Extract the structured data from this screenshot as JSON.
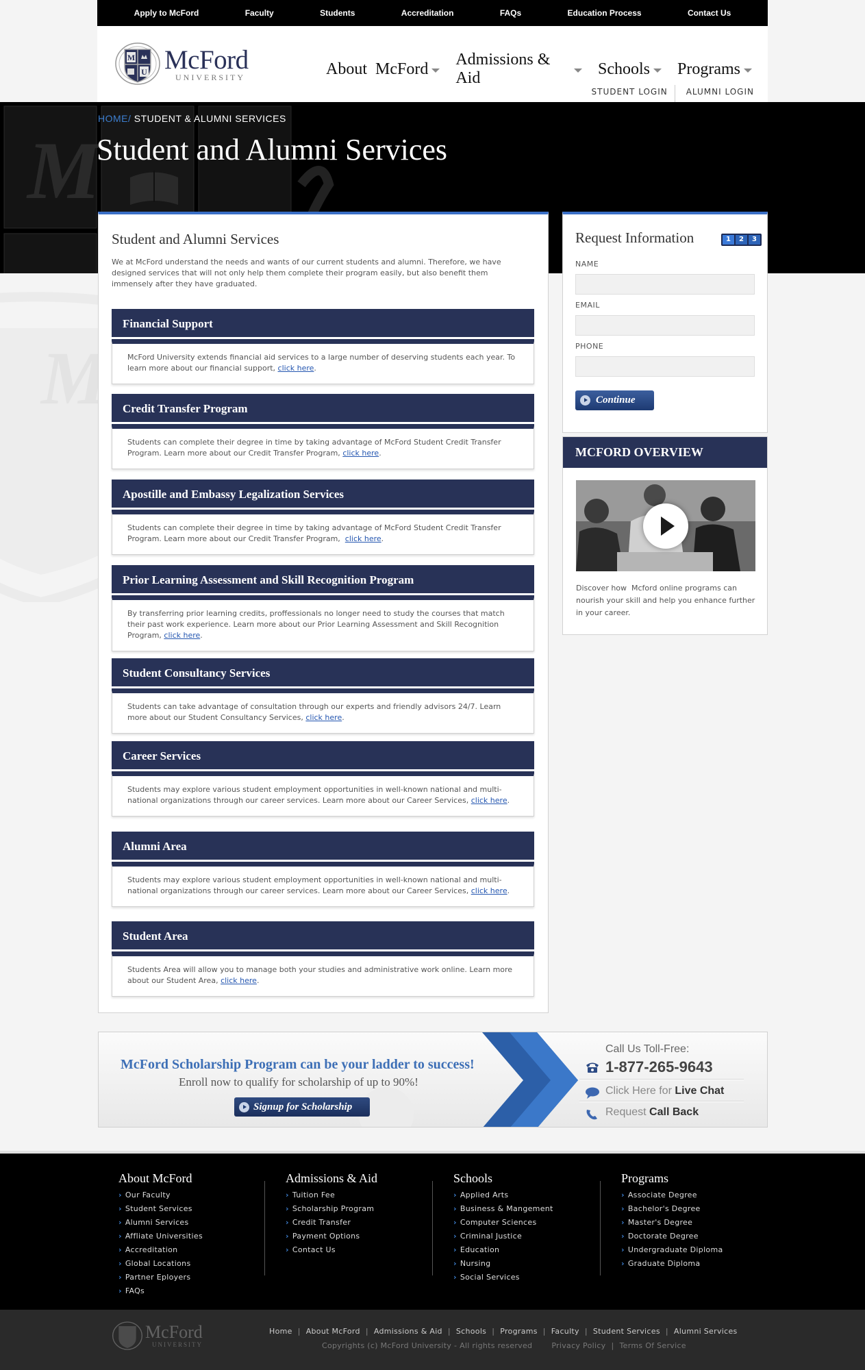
{
  "topbar": {
    "items": [
      "Apply to McFord",
      "Faculty",
      "Students",
      "Accreditation",
      "FAQs",
      "Education Process",
      "Contact Us"
    ]
  },
  "logo": {
    "name": "McFord",
    "sub": "UNIVERSITY",
    "crest_letters": [
      "M",
      "U"
    ]
  },
  "nav": {
    "items": [
      "About  McFord",
      "Admissions & Aid",
      "Schools",
      "Programs"
    ]
  },
  "logins": {
    "student": "STUDENT LOGIN",
    "alumni": "ALUMNI LOGIN"
  },
  "breadcrumb": {
    "home": "HOME",
    "sep": "/",
    "current": "STUDENT & ALUMNI SERVICES"
  },
  "page_title": "Student and Alumni Services",
  "main": {
    "heading": "Student and Alumni Services",
    "intro": "We at McFord understand the needs and wants of our current students and alumni. Therefore, we have designed services that will not only help them complete their program easily, but also benefit them immensely after they have graduated.",
    "sections": [
      {
        "title": "Financial Support",
        "text": "McFord University extends financial aid services to a large number of deserving students each year. To learn more about our financial support, ",
        "link": "click here",
        "end": "."
      },
      {
        "title": "Credit Transfer Program",
        "text": "Students can complete their degree in time by taking advantage of McFord Student Credit Transfer Program. Learn more about our Credit Transfer Program, ",
        "link": "click here",
        "end": "."
      },
      {
        "title": "Apostille and Embassy Legalization Services",
        "text": "Students can complete their degree in time by taking advantage of McFord Student Credit Transfer Program. Learn more about our Credit Transfer Program,  ",
        "link": "click here",
        "end": "."
      },
      {
        "title": "Prior Learning Assessment and Skill Recognition Program",
        "text": "By transferring prior learning credits, proffessionals no longer need to study the courses that match their past work experience.  Learn more about our Prior Learning Assessment and Skill Recognition Program, ",
        "link": "click here",
        "end": "."
      },
      {
        "title": "Student Consultancy Services",
        "text": "Students can take advantage of consultation through our experts and friendly advisors 24/7. Learn more about our Student Consultancy Services, ",
        "link": "click here",
        "end": "."
      },
      {
        "title": "Career Services",
        "text": "Students may explore various student employment opportunities in well-known national and multi-national organizations through our career services. Learn more about our Career Services, ",
        "link": "click here",
        "end": "."
      },
      {
        "title": "Alumni Area",
        "text": "Students may explore various student employment opportunities in well-known national and multi-national organizations through our career services. Learn more about our Career Services, ",
        "link": "click here",
        "end": "."
      },
      {
        "title": "Student Area",
        "text": "Students Area will allow you to manage both your studies and administrative work online. Learn more about our Student Area, ",
        "link": "click here",
        "end": "."
      }
    ]
  },
  "request": {
    "title": "Request Information",
    "steps": [
      "1",
      "2",
      "3"
    ],
    "fields": [
      {
        "label": "NAME",
        "value": ""
      },
      {
        "label": "EMAIL",
        "value": ""
      },
      {
        "label": "PHONE",
        "value": ""
      }
    ],
    "button": "Continue"
  },
  "overview": {
    "title": "MCFORD OVERVIEW",
    "text": "Discover how  Mcford online programs can nourish your skill and help you enhance further in your career."
  },
  "banner": {
    "headline": "McFord Scholarship Program can be your ladder to success!",
    "sub": "Enroll now to qualify for scholarship of up to 90%!",
    "button": "Signup for Scholarship",
    "call_label": "Call Us Toll-Free:",
    "phone": "1-877-265-9643",
    "chat_pre": "Click Here for ",
    "chat_bold": "Live Chat",
    "callback_pre": "Request ",
    "callback_bold": "Call Back"
  },
  "footer": {
    "columns": [
      {
        "title": "About McFord",
        "links": [
          "Our Faculty",
          "Student Services",
          "Alumni Services",
          "Affliate Universities",
          "Accreditation",
          "Global Locations",
          "Partner Eployers",
          "FAQs"
        ]
      },
      {
        "title": "Admissions & Aid",
        "links": [
          "Tuition Fee",
          "Scholarship Program",
          "Credit Transfer",
          "Payment Options",
          "Contact Us"
        ]
      },
      {
        "title": "Schools",
        "links": [
          "Applied Arts",
          "Business & Mangement",
          "Computer Sciences",
          "Criminal Justice",
          "Education",
          "Nursing",
          "Social Services"
        ]
      },
      {
        "title": "Programs",
        "links": [
          "Associate Degree",
          "Bachelor's Degree",
          "Master's Degree",
          "Doctorate Degree",
          "Undergraduate Diploma",
          "Graduate Diploma"
        ]
      }
    ],
    "bottom_links": [
      "Home",
      "About McFord",
      "Admissions & Aid",
      "Schools",
      "Programs",
      "Faculty",
      "Student Services",
      "Alumni Services"
    ],
    "copyright": "Copyrights (c) McFord University - All rights reserved",
    "privacy": "Privacy Policy",
    "terms": "Terms Of Service",
    "logo_name": "McFord",
    "logo_sub": "UNIVERSITY"
  },
  "colors": {
    "navy": "#283257",
    "accent_blue": "#3a6fc6",
    "link": "#2456b0"
  }
}
